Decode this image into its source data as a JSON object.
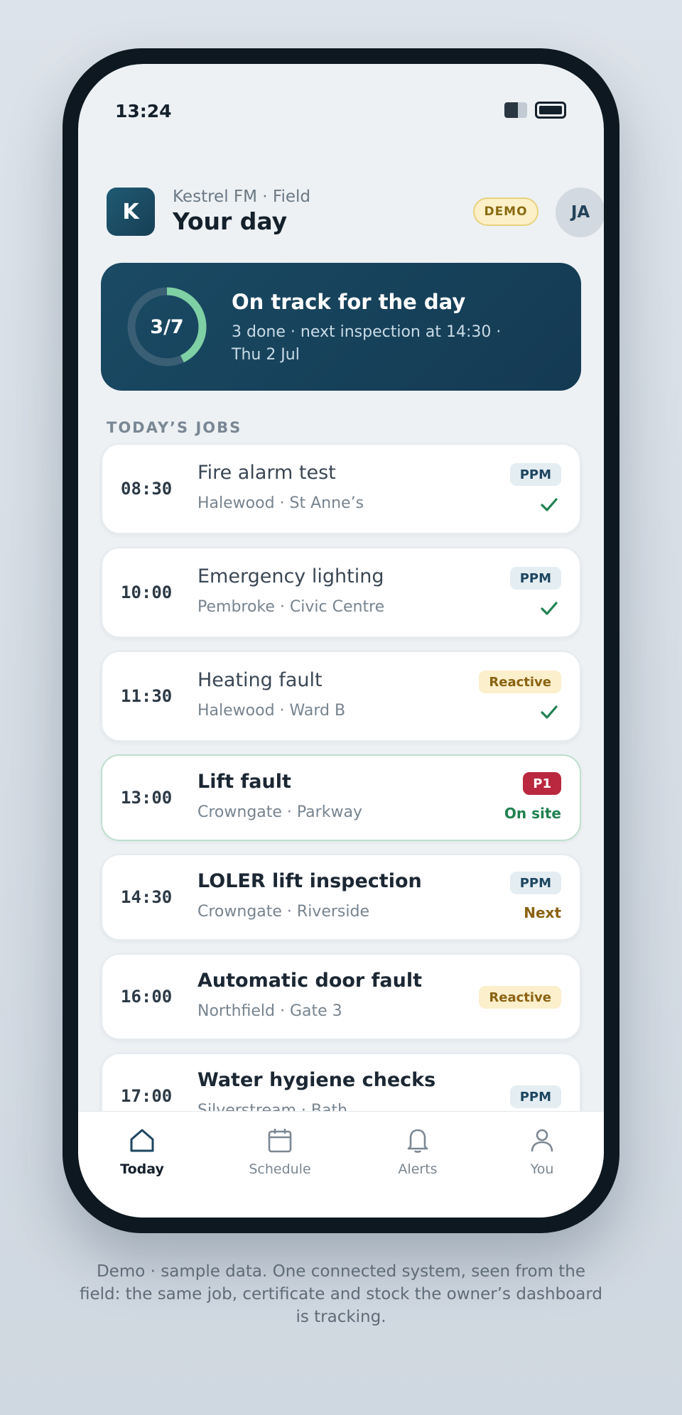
{
  "status": {
    "time": "13:24"
  },
  "header": {
    "logo_letter": "K",
    "org": "Kestrel FM · Field",
    "title": "Your day",
    "badge": "DEMO",
    "avatar": "JA"
  },
  "hero": {
    "progress_label": "3/7",
    "progress_fraction": 0.4286,
    "title": "On track for the day",
    "subtitle": "3 done · next inspection at 14:30 · Thu 2 Jul"
  },
  "section_label": "TODAY’S JOBS",
  "jobs": [
    {
      "time": "08:30",
      "title": "Fire alarm test",
      "location": "Halewood · St Anne’s",
      "tag": "PPM",
      "status": "done"
    },
    {
      "time": "10:00",
      "title": "Emergency lighting",
      "location": "Pembroke · Civic Centre",
      "tag": "PPM",
      "status": "done"
    },
    {
      "time": "11:30",
      "title": "Heating fault",
      "location": "Halewood · Ward B",
      "tag": "Reactive",
      "status": "done"
    },
    {
      "time": "13:00",
      "title": "Lift fault",
      "location": "Crowngate · Parkway",
      "tag": "P1",
      "status": "On site"
    },
    {
      "time": "14:30",
      "title": "LOLER lift inspection",
      "location": "Crowngate · Riverside",
      "tag": "PPM",
      "status": "Next"
    },
    {
      "time": "16:00",
      "title": "Automatic door fault",
      "location": "Northfield · Gate 3",
      "tag": "Reactive",
      "status": ""
    },
    {
      "time": "17:00",
      "title": "Water hygiene checks",
      "location": "Silverstream · Bath",
      "tag": "PPM",
      "status": ""
    }
  ],
  "tabs": [
    {
      "label": "Today",
      "icon": "home-icon",
      "active": true
    },
    {
      "label": "Schedule",
      "icon": "calendar-icon",
      "active": false
    },
    {
      "label": "Alerts",
      "icon": "bell-icon",
      "active": false
    },
    {
      "label": "You",
      "icon": "user-icon",
      "active": false
    }
  ],
  "footer": "Demo · sample data. One connected system, seen from the field: the same job, certificate and stock the owner’s dashboard is tracking.",
  "colors": {
    "brand": "#173f55",
    "progress": "#7fd0a4",
    "ppm": "#1d4660",
    "reactive": "#8a6212",
    "p1": "#b9283e",
    "success": "#1f8150"
  }
}
